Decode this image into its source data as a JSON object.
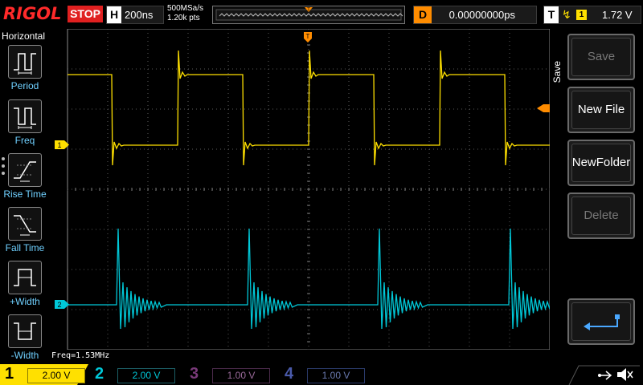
{
  "header": {
    "brand": "RIGOL",
    "run_state": "STOP",
    "timebase_key": "H",
    "timebase": "200ns",
    "sample_rate": "500MSa/s",
    "memory_depth": "1.20k pts",
    "trigger_marker": "T",
    "delay_key": "D",
    "delay": "0.00000000ps",
    "trigger_key": "T",
    "trigger_source": "1",
    "trigger_level": "1.72 V"
  },
  "left_menu": {
    "title": "Horizontal",
    "items": [
      {
        "label": "Period"
      },
      {
        "label": "Freq"
      },
      {
        "label": "Rise Time"
      },
      {
        "label": "Fall Time"
      },
      {
        "label": "+Width"
      },
      {
        "label": "-Width"
      }
    ]
  },
  "right_menu": {
    "title": "Save",
    "buttons": [
      {
        "label": "Save"
      },
      {
        "label": "New File"
      },
      {
        "label": "NewFolder"
      },
      {
        "label": "Delete"
      },
      {
        "label": ""
      }
    ]
  },
  "display": {
    "ch1_marker": "1",
    "ch2_marker": "2",
    "measurement": "Freq=1.53MHz"
  },
  "channels": [
    {
      "num": "1",
      "scale": "2.00 V",
      "color": "#ffe000"
    },
    {
      "num": "2",
      "scale": "2.00 V",
      "color": "#00c8d8"
    },
    {
      "num": "3",
      "scale": "1.00 V",
      "color": "#c040c0"
    },
    {
      "num": "4",
      "scale": "1.00 V",
      "color": "#3060ff"
    }
  ],
  "colors": {
    "ch1": "#ffe000",
    "ch2": "#00c8d8",
    "trigger": "#ff8c00",
    "stop": "#e02020",
    "label_cyan": "#6fd0ff"
  }
}
